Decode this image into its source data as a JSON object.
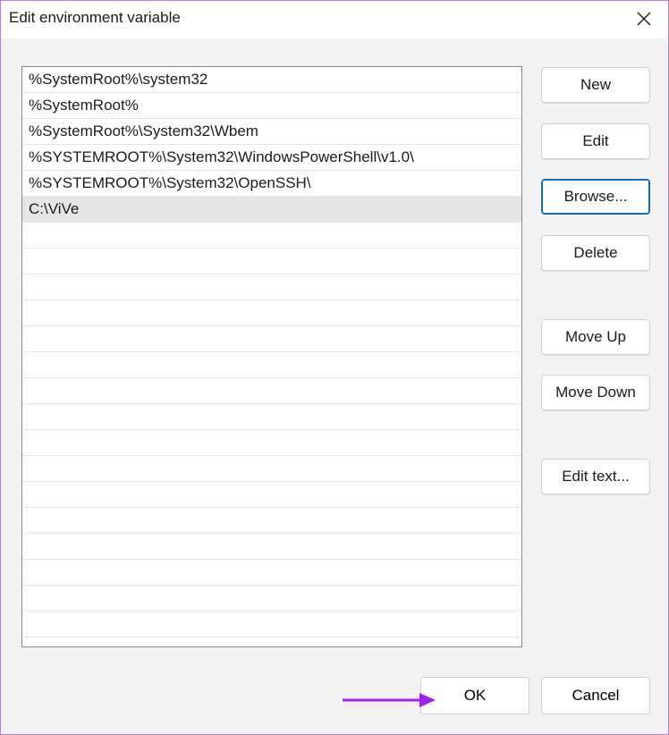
{
  "window": {
    "title": "Edit environment variable"
  },
  "list": {
    "items": [
      "%SystemRoot%\\system32",
      "%SystemRoot%",
      "%SystemRoot%\\System32\\Wbem",
      "%SYSTEMROOT%\\System32\\WindowsPowerShell\\v1.0\\",
      "%SYSTEMROOT%\\System32\\OpenSSH\\",
      "C:\\ViVe"
    ],
    "selected_index": 5
  },
  "buttons": {
    "new": "New",
    "edit": "Edit",
    "browse": "Browse...",
    "delete": "Delete",
    "move_up": "Move Up",
    "move_down": "Move Down",
    "edit_text": "Edit text...",
    "ok": "OK",
    "cancel": "Cancel"
  },
  "colors": {
    "window_border": "#b87ae6",
    "annotation_arrow": "#a020f0",
    "focus_accent": "#0f6cbd",
    "selected_row": "#e5e5e5"
  }
}
